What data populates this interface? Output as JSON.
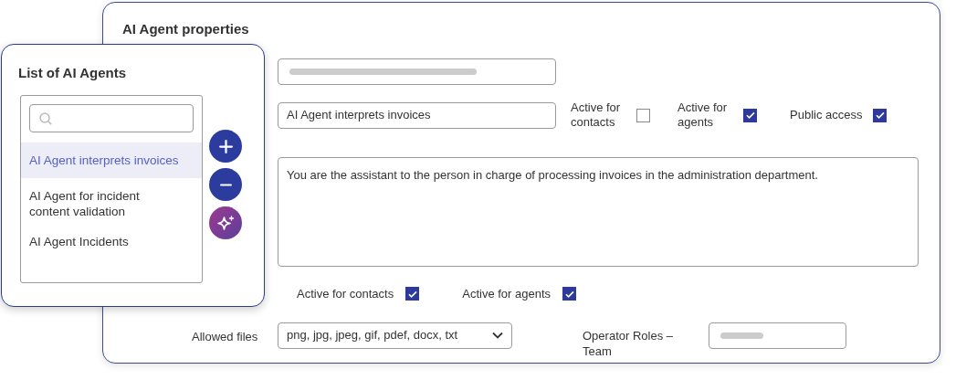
{
  "properties": {
    "title": "AI Agent properties",
    "name_value": "AI Agent interprets invoices",
    "flags": [
      {
        "label": "Active for contacts",
        "checked": false
      },
      {
        "label": "Active for agents",
        "checked": true
      },
      {
        "label": "Public access",
        "checked": true
      }
    ],
    "prompt": "You are the assistant to the person in charge of processing invoices in the administration department.",
    "channels": [
      {
        "label": "Active for contacts",
        "checked": true
      },
      {
        "label": "Active for agents",
        "checked": true
      }
    ],
    "allowed_files": {
      "label": "Allowed files",
      "value": "png, jpg, jpeg, gif, pdef, docx, txt"
    },
    "operator_roles": {
      "label": "Operator Roles – Team"
    }
  },
  "agent_list": {
    "title": "List of AI Agents",
    "items": [
      {
        "label": "AI Agent interprets invoices",
        "selected": true
      },
      {
        "label": "AI Agent for incident content validation",
        "selected": false
      },
      {
        "label": "AI Agent Incidents",
        "selected": false
      }
    ],
    "actions": [
      {
        "kind": "add"
      },
      {
        "kind": "remove"
      },
      {
        "kind": "ai"
      }
    ]
  }
}
